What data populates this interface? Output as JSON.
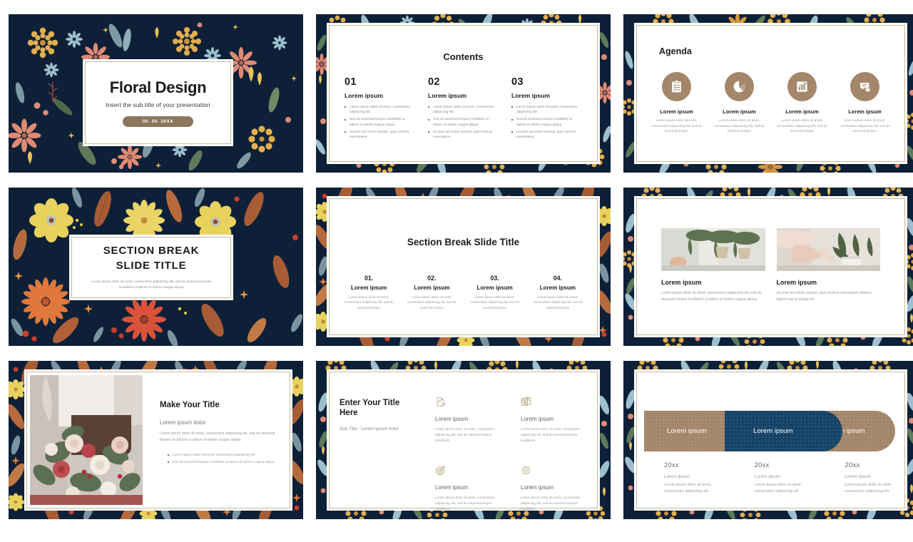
{
  "deck": {
    "title": "Floral Design",
    "accent_tan": "#a4866a",
    "accent_navy": "#164468",
    "pattern_bg": "#0d2038"
  },
  "slides": [
    {
      "name": "title-slide",
      "title": "Floral Design",
      "subtitle": "Insert the sub title of your presentation",
      "date_badge": "00. 00. 20XX"
    },
    {
      "name": "contents-slide",
      "heading": "Contents",
      "columns": [
        {
          "number": "01",
          "label": "Lorem ipsum",
          "bullets": [
            "Lorem ipsum dolor sit amet, consectetur adipiscing elit",
            "Sed do eiusmod tempor incididunt ut labore et dolore magna aliqua",
            "Ut enim ad minim veniam, quis nostrud exercitation"
          ]
        },
        {
          "number": "02",
          "label": "Lorem ipsum",
          "bullets": [
            "Lorem ipsum dolor sit amet, consectetur adipiscing elit",
            "Sed do eiusmod tempor incididunt ut labore et dolore magna aliqua",
            "Ut enim ad minim veniam, quis nostrud exercitation"
          ]
        },
        {
          "number": "03",
          "label": "Lorem ipsum",
          "bullets": [
            "Lorem ipsum dolor sit amet, consectetur adipiscing elit",
            "Sed do eiusmod tempor incididunt ut labore et dolore magna aliqua",
            "Ut enim ad minim veniam, quis nostrud exercitation"
          ]
        }
      ]
    },
    {
      "name": "agenda-slide",
      "heading": "Agenda",
      "items": [
        {
          "icon": "clipboard-checklist-icon",
          "label": "Lorem ipsum",
          "text": "Lorem ipsum dolor sit amet, consectetur adipiscing elit, sed do eiusmod tempor"
        },
        {
          "icon": "pie-chart-icon",
          "label": "Lorem ipsum",
          "text": "Lorem ipsum dolor sit amet, consectetur adipiscing elit, sed do eiusmod tempor"
        },
        {
          "icon": "bar-chart-growth-icon",
          "label": "Lorem ipsum",
          "text": "Lorem ipsum dolor sit amet, consectetur adipiscing elit, sed do eiusmod tempor"
        },
        {
          "icon": "chat-bubbles-icon",
          "label": "Lorem ipsum",
          "text": "Lorem ipsum dolor sit amet, consectetur adipiscing elit, sed do eiusmod tempor"
        }
      ]
    },
    {
      "name": "section-break-slide",
      "title_line1": "SECTION BREAK",
      "title_line2": "SLIDE TITLE",
      "text": "Lorem ipsum dolor sit amet, consectetur adipiscing elit, sed do eiusmod tempor incididunt ut labore et dolore magna aliqua"
    },
    {
      "name": "section-break-columns-slide",
      "heading": "Section Break Slide Title",
      "columns": [
        {
          "number": "01.",
          "label": "Lorem ipsum",
          "text": "Lorem ipsum dolor sit amet, consectetur adipiscing elit, sed do eiusmod tempor"
        },
        {
          "number": "02.",
          "label": "Lorem ipsum",
          "text": "Lorem ipsum dolor sit amet, consectetur adipiscing elit, sed do eiusmod tempor"
        },
        {
          "number": "03.",
          "label": "Lorem ipsum",
          "text": "Lorem ipsum dolor sit amet, consectetur adipiscing elit, sed do eiusmod tempor"
        },
        {
          "number": "04.",
          "label": "Lorem ipsum",
          "text": "Lorem ipsum dolor sit amet, consectetur adipiscing elit, sed do eiusmod tempor"
        }
      ]
    },
    {
      "name": "two-photo-slide",
      "columns": [
        {
          "photo": "hanging-plants-photo",
          "label": "Lorem ipsum",
          "text": "Lorem ipsum dolor sit amet, consectetur adipiscing elit, sed do eiusmod tempor incididunt ut labore et dolore magna aliqua."
        },
        {
          "photo": "florist-arranging-photo",
          "label": "Lorem ipsum",
          "text": "Ut enim ad minim veniam, quis nostrud exercitation ullamco laboris nisi ut aliquip ex"
        }
      ]
    },
    {
      "name": "image-text-slide",
      "photo": "bouquet-photo",
      "title": "Make Your Title",
      "subtitle": "Lorem ipsum dolor",
      "paragraph": "Lorem ipsum dolor sit amet, consectetur adipiscing elit, sed do eiusmod tempor incididunt ut labore et dolore magna aliqua.",
      "bullets": [
        "Lorem ipsum dolor sit amet, consectetur adipiscing elit",
        "Sed do eiusmod tempor incididunt ut labore et dolore magna aliqua"
      ]
    },
    {
      "name": "four-icon-slide",
      "title": "Enter Your Title Here",
      "subtitle": "Sub Title : Lorem ipsum dolor",
      "items": [
        {
          "icon": "document-edit-icon",
          "label": "Lorem ipsum",
          "text": "Lorem ipsum dolor sit amet, consectetur adipiscing elit, sed do eiusmod tempor incididunt"
        },
        {
          "icon": "news-document-icon",
          "label": "Lorem ipsum",
          "text": "Lorem ipsum dolor sit amet, consectetur adipiscing elit, sed do eiusmod tempor incididunt"
        },
        {
          "icon": "target-icon",
          "label": "Lorem ipsum",
          "text": "Lorem ipsum dolor sit amet, consectetur adipiscing elit, sed do eiusmod tempor incididunt"
        },
        {
          "icon": "gear-settings-icon",
          "label": "Lorem ipsum",
          "text": "Lorem ipsum dolor sit amet, consectetur adipiscing elit, sed do eiusmod tempor incididunt"
        }
      ]
    },
    {
      "name": "timeline-slide",
      "pills": [
        {
          "label": "Lorem ipsum",
          "color": "#a4866a"
        },
        {
          "label": "Lorem ipsum",
          "color": "#164468"
        },
        {
          "label": "Lorem ipsum",
          "color": "#a4866a"
        }
      ],
      "columns": [
        {
          "year": "20xx",
          "label": "Lorem ipsum",
          "text": "Lorem ipsum dolor sit amet, consectetur adipiscing elit"
        },
        {
          "year": "20xx",
          "label": "Lorem ipsum",
          "text": "Lorem ipsum dolor sit amet, consectetur adipiscing elit"
        },
        {
          "year": "20xx",
          "label": "Lorem ipsum",
          "text": "Lorem ipsum dolor sit amet, consectetur adipiscing elit"
        }
      ]
    }
  ]
}
